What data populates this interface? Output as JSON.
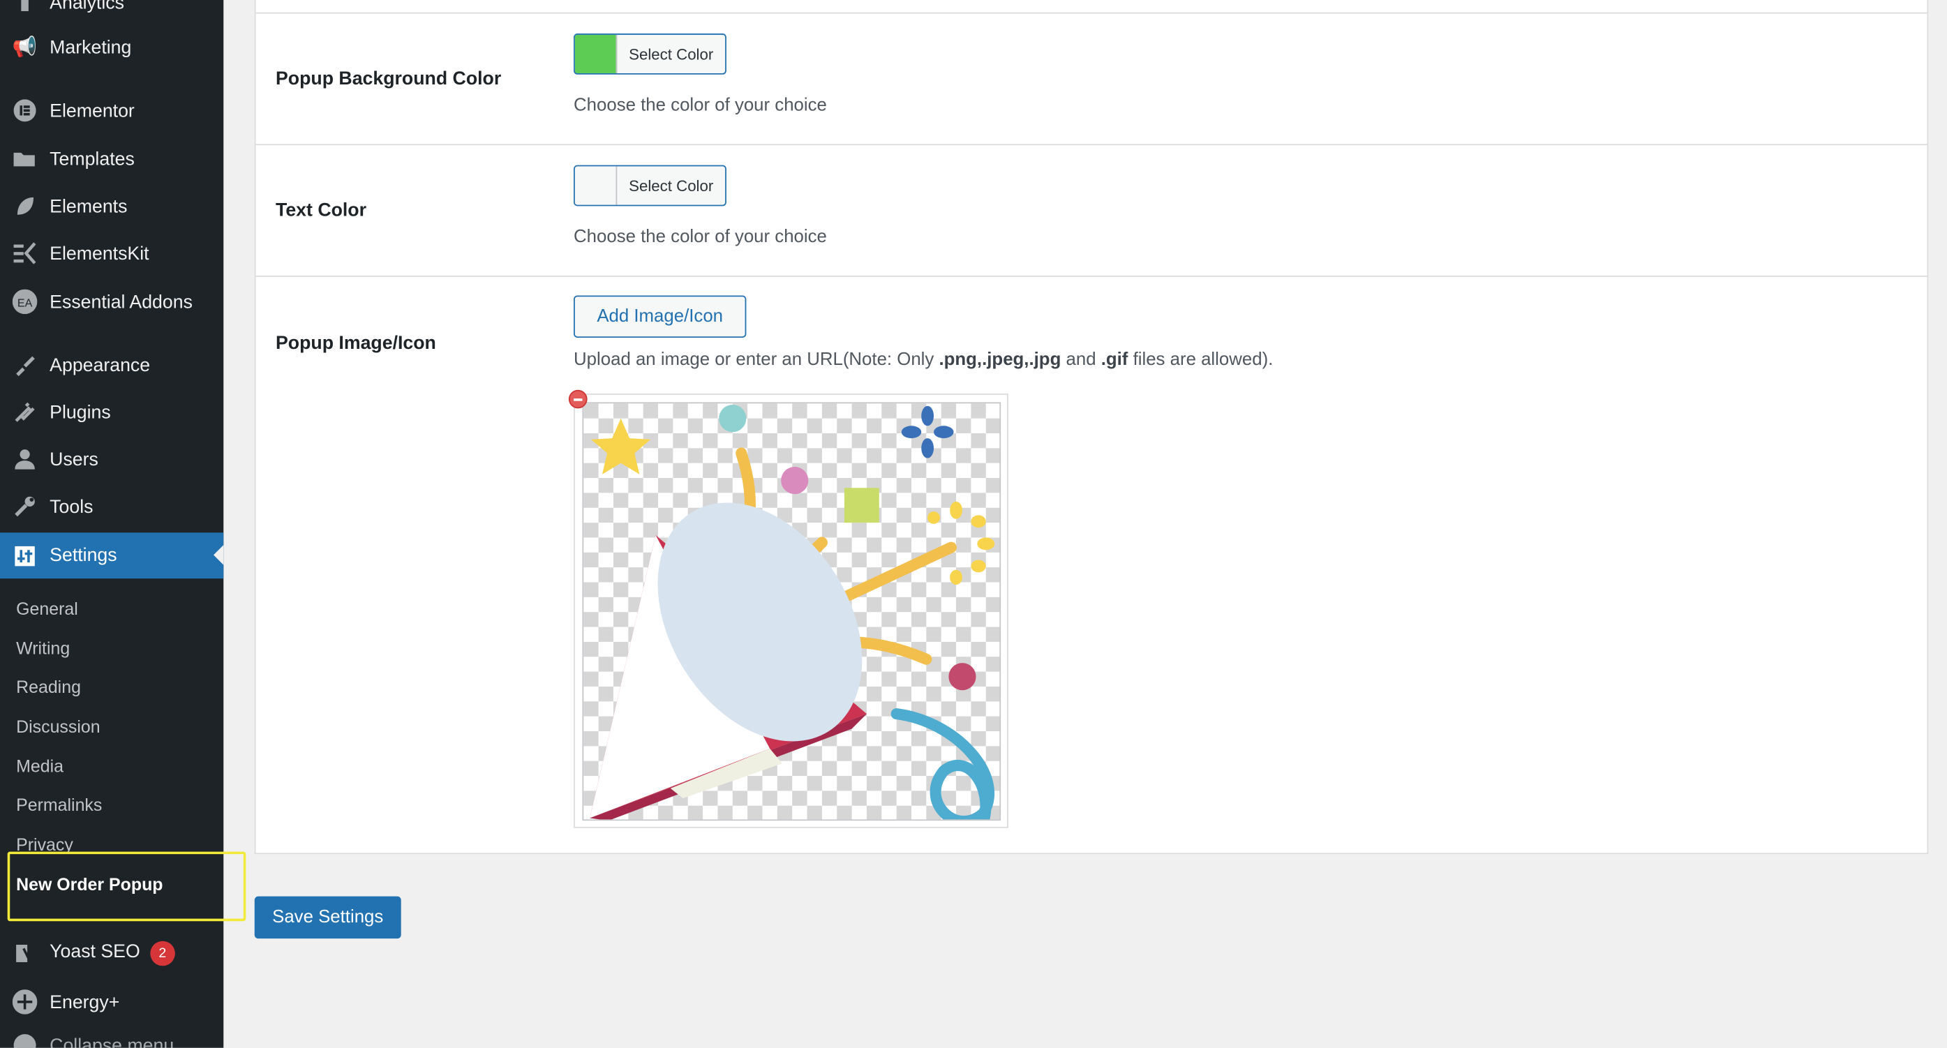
{
  "sidebar": {
    "items": [
      {
        "label": "Analytics",
        "icon": "bar-chart-icon"
      },
      {
        "label": "Marketing",
        "icon": "megaphone-icon"
      },
      {
        "label": "Elementor",
        "icon": "elementor-icon"
      },
      {
        "label": "Templates",
        "icon": "folder-icon"
      },
      {
        "label": "Elements",
        "icon": "leaf-icon"
      },
      {
        "label": "ElementsKit",
        "icon": "elementskit-icon"
      },
      {
        "label": "Essential Addons",
        "icon": "ea-icon"
      },
      {
        "label": "Appearance",
        "icon": "paintbrush-icon"
      },
      {
        "label": "Plugins",
        "icon": "plug-icon"
      },
      {
        "label": "Users",
        "icon": "user-icon"
      },
      {
        "label": "Tools",
        "icon": "wrench-icon"
      },
      {
        "label": "Settings",
        "icon": "settings-icon"
      },
      {
        "label": "Yoast SEO",
        "icon": "yoast-icon",
        "badge": "2"
      },
      {
        "label": "Energy+",
        "icon": "plus-circle-icon"
      },
      {
        "label": "Collapse menu",
        "icon": "collapse-icon"
      }
    ],
    "submenu": [
      "General",
      "Writing",
      "Reading",
      "Discussion",
      "Media",
      "Permalinks",
      "Privacy",
      "New Order Popup"
    ]
  },
  "form": {
    "bg_color": {
      "label": "Popup Background Color",
      "button": "Select Color",
      "swatch": "#5ccc55",
      "desc": "Choose the color of your choice"
    },
    "text_color": {
      "label": "Text Color",
      "button": "Select Color",
      "swatch": "#f6f7f7",
      "desc": "Choose the color of your choice"
    },
    "image": {
      "label": "Popup Image/Icon",
      "button": "Add Image/Icon",
      "desc_prefix": "Upload an image or enter an URL(Note: Only ",
      "desc_ext1": ".png,.jpeg,.jpg",
      "desc_mid": " and ",
      "desc_ext2": ".gif",
      "desc_suffix": " files are allowed).",
      "preview_icon": "party-popper-icon",
      "remove_icon": "remove-icon"
    }
  },
  "save_button": "Save Settings",
  "colors": {
    "sidebar_bg": "#1d2327",
    "accent": "#2271b1",
    "highlight": "#f2ea3a"
  }
}
